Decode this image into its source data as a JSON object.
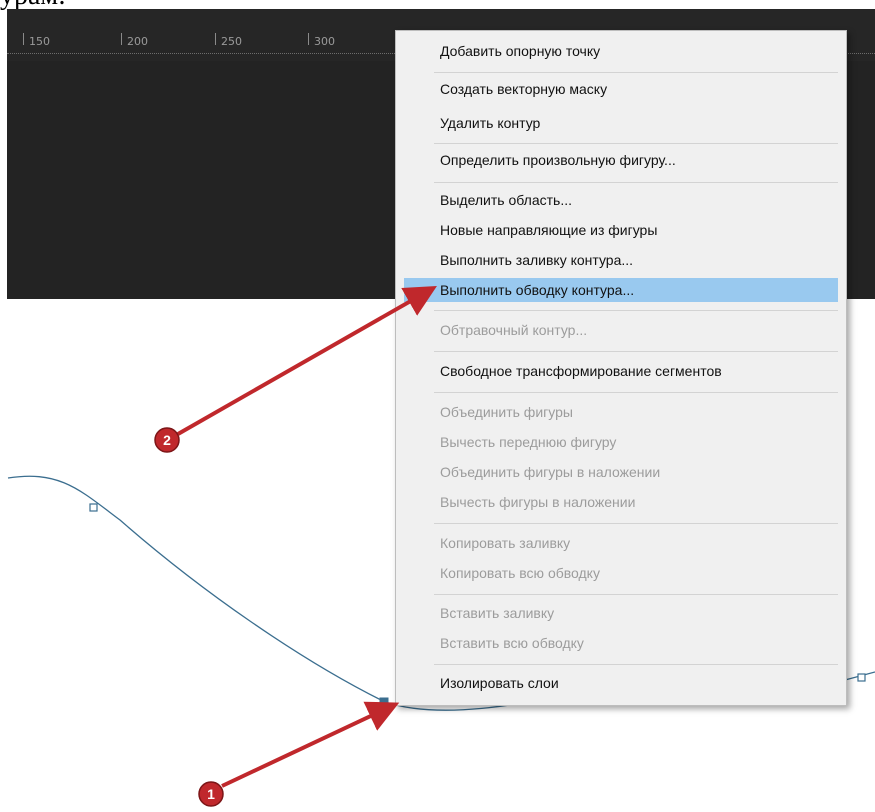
{
  "caption": {
    "text": "урам:"
  },
  "ruler": {
    "ticks": [
      "150",
      "200",
      "250",
      "300"
    ]
  },
  "menu": {
    "items": [
      {
        "label": "Добавить опорную точку",
        "enabled": true
      },
      {
        "label": "Создать векторную маску",
        "enabled": true
      },
      {
        "label": "Удалить контур",
        "enabled": true
      },
      {
        "label": "Определить произвольную фигуру...",
        "enabled": true
      },
      {
        "label": "Выделить область...",
        "enabled": true
      },
      {
        "label": "Новые направляющие из фигуры",
        "enabled": true
      },
      {
        "label": "Выполнить заливку контура...",
        "enabled": true
      },
      {
        "label": "Выполнить обводку контура...",
        "enabled": true,
        "highlighted": true
      },
      {
        "label": "Обтравочный контур...",
        "enabled": false
      },
      {
        "label": "Свободное трансформирование сегментов",
        "enabled": true
      },
      {
        "label": "Объединить фигуры",
        "enabled": false
      },
      {
        "label": "Вычесть переднюю фигуру",
        "enabled": false
      },
      {
        "label": "Объединить фигуры в наложении",
        "enabled": false
      },
      {
        "label": "Вычесть фигуры в наложении",
        "enabled": false
      },
      {
        "label": "Копировать заливку",
        "enabled": false
      },
      {
        "label": "Копировать всю обводку",
        "enabled": false
      },
      {
        "label": "Вставить заливку",
        "enabled": false
      },
      {
        "label": "Вставить всю обводку",
        "enabled": false
      },
      {
        "label": "Изолировать слои",
        "enabled": true
      }
    ]
  },
  "annotations": {
    "marker_1": "1",
    "marker_2": "2",
    "marker_color": "#c0282c"
  },
  "colors": {
    "canvas_dark": "#232323",
    "menu_bg": "#f0f0f0",
    "highlight": "#99c9ef",
    "path_stroke": "#3b6e8f"
  }
}
